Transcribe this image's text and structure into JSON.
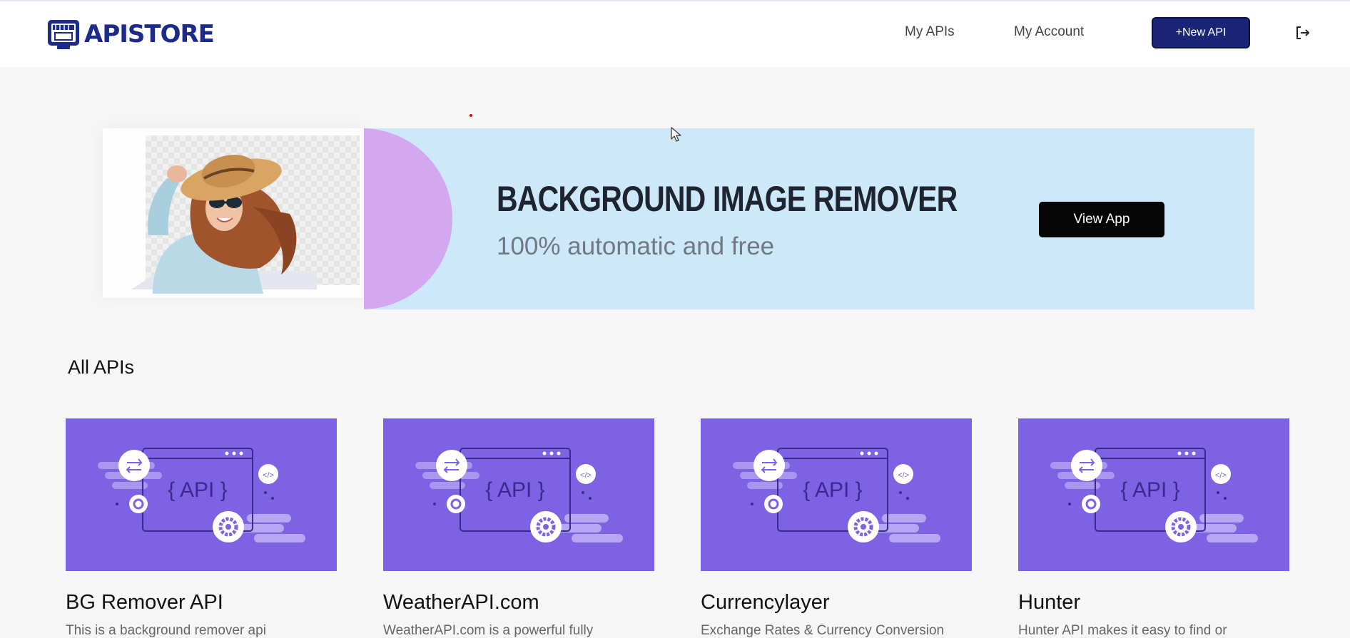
{
  "header": {
    "logo_text": "APISTORE",
    "nav": [
      {
        "label": "My APIs"
      },
      {
        "label": "My Account"
      }
    ],
    "new_api_label": "+New API",
    "logout_icon": "logout-icon"
  },
  "banner": {
    "title": "BACKGROUND IMAGE REMOVER",
    "subtitle": "100% automatic and free",
    "button_label": "View App",
    "background_color": "#cde8f8",
    "accent_color": "#d4a8f0"
  },
  "section": {
    "title": "All APIs"
  },
  "cards": [
    {
      "title": "BG Remover API",
      "description": "This is a background remover api",
      "image_label": "{ API }"
    },
    {
      "title": "WeatherAPI.com",
      "description": "WeatherAPI.com is a powerful fully",
      "image_label": "{ API }"
    },
    {
      "title": "Currencylayer",
      "description": "Exchange Rates & Currency Conversion",
      "image_label": "{ API }"
    },
    {
      "title": "Hunter",
      "description": "Hunter API makes it easy to find or",
      "image_label": "{ API }"
    }
  ],
  "colors": {
    "brand": "#1c2a8a",
    "primary_button": "#1b2577",
    "card_background": "#7d63e4"
  }
}
